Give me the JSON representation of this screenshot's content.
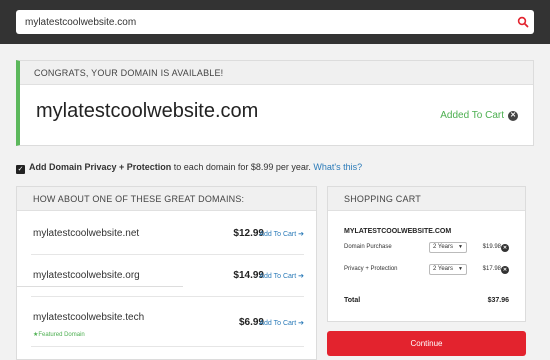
{
  "search": {
    "value": "mylatestcoolwebsite.com"
  },
  "availability": {
    "header": "CONGRATS, YOUR DOMAIN IS AVAILABLE!",
    "domain": "mylatestcoolwebsite.com",
    "added_label": "Added To Cart",
    "accent_color": "#5cb85c"
  },
  "privacy": {
    "checked": true,
    "bold_text": "Add Domain Privacy + Protection",
    "text": " to each domain for $8.99 per year. ",
    "link": "What's this?"
  },
  "suggestions": {
    "header": "HOW ABOUT ONE OF THESE GREAT DOMAINS:",
    "add_label": "Add To Cart",
    "items": [
      {
        "name": "mylatestcoolwebsite.net",
        "price": "$12.99"
      },
      {
        "name": "mylatestcoolwebsite.org",
        "price": "$14.99"
      },
      {
        "name": "mylatestcoolwebsite.tech",
        "price": "$6.99",
        "badge": "Featured Domain"
      }
    ]
  },
  "cart": {
    "header": "SHOPPING CART",
    "domain": "MYLATESTCOOLWEBSITE.COM",
    "lines": [
      {
        "label": "Domain Purchase",
        "term": "2 Years",
        "price": "$19.98"
      },
      {
        "label": "Privacy + Protection",
        "term": "2 Years",
        "price": "$17.98"
      }
    ],
    "total_label": "Total",
    "total_value": "$37.96"
  },
  "continue_label": "Continue",
  "colors": {
    "topbar": "#333333",
    "link": "#2a7ab8",
    "success": "#4caf50",
    "cta": "#e3232e"
  }
}
